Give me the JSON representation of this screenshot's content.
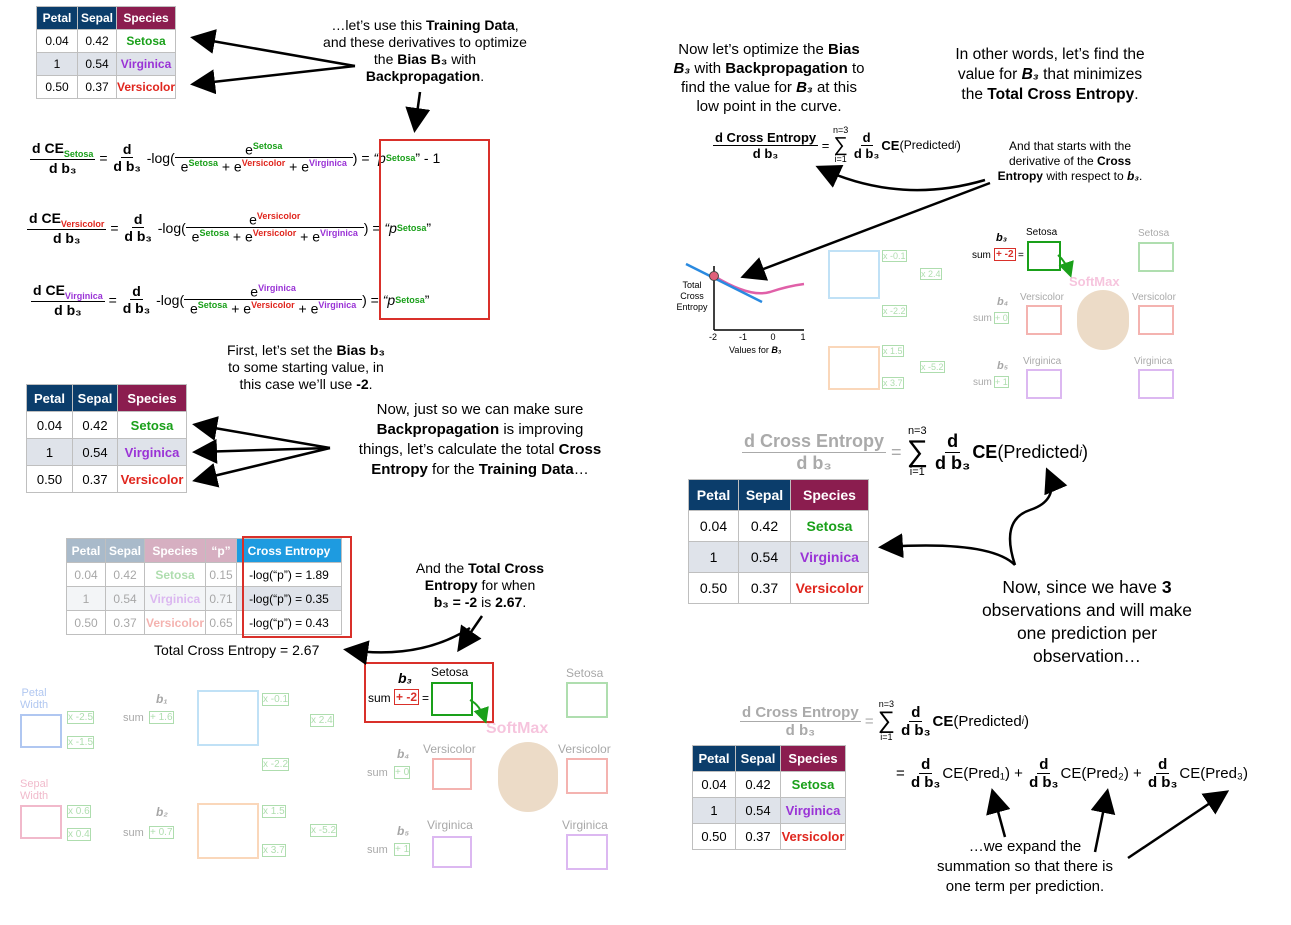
{
  "iris": {
    "headers": [
      "Petal",
      "Sepal",
      "Species"
    ],
    "rows": [
      {
        "petal": "0.04",
        "sepal": "0.42",
        "species": "Setosa"
      },
      {
        "petal": "1",
        "sepal": "0.54",
        "species": "Virginica"
      },
      {
        "petal": "0.50",
        "sepal": "0.37",
        "species": "Versicolor"
      }
    ]
  },
  "ce_table": {
    "headers": [
      "Petal",
      "Sepal",
      "Species",
      "“p”",
      "Cross Entropy"
    ],
    "p": [
      "0.15",
      "0.71",
      "0.65"
    ],
    "ce": [
      "-log(“p”) = 1.89",
      "-log(“p”) = 0.35",
      "-log(“p”) = 0.43"
    ],
    "total": "Total Cross Entropy = 2.67"
  },
  "text": {
    "intro_1": "…let’s use this",
    "intro_2": "Training Data",
    "intro_3": ",",
    "intro_4": "and these derivatives to optimize",
    "intro_5": "the",
    "intro_6": "Bias B₃",
    "intro_7": "with",
    "intro_8": "Backpropagation",
    "intro_9": ".",
    "first_1": "First, let’s set the",
    "first_2": "Bias b₃",
    "first_3": "to some starting value, in",
    "first_4": "this case we’ll use",
    "first_5": "-2",
    "first_6": ".",
    "now_1": "Now, just so we can make sure",
    "now_2": "Backpropagation",
    "now_3": "is improving",
    "now_4": "things, let’s calculate the total",
    "now_5": "Cross",
    "now_6": "Entropy",
    "now_7": "for the",
    "now_8": "Training Data",
    "now_9": "…",
    "andtotal_1": "And the",
    "andtotal_2": "Total Cross",
    "andtotal_3": "Entropy",
    "andtotal_4": "for when",
    "andtotal_5": "b₃ = -2",
    "andtotal_6": "is",
    "andtotal_7": "2.67",
    "andtotal_8": ".",
    "opt_1": "Now let’s optimize the",
    "opt_2": "Bias",
    "opt_3": "B₃",
    "opt_4": "with",
    "opt_5": "Backpropagation",
    "opt_6": "to",
    "opt_7": "find the value for",
    "opt_8": "B₃",
    "opt_9": "at this",
    "opt_10": "low point in the curve.",
    "other_1": "In other words, let’s find the",
    "other_2": "value for",
    "other_3": "B₃",
    "other_4": "that minimizes",
    "other_5": "the",
    "other_6": "Total Cross Entropy",
    "other_7": ".",
    "starts_1": "And that starts with the",
    "starts_2": "derivative of the",
    "starts_3": "Cross",
    "starts_4": "Entropy",
    "starts_5": "with respect to",
    "starts_6": "b₃",
    "starts_7": ".",
    "since_1": "Now, since we have",
    "since_2": "3",
    "since_3": "observations and will make",
    "since_4": "one prediction per",
    "since_5": "observation…",
    "expand_1": "…we expand the",
    "expand_2": "summation so that there is",
    "expand_3": "one term per prediction."
  },
  "equations": {
    "d": "d",
    "db3": "d b₃",
    "ce": "CE",
    "setosa": "Setosa",
    "versicolor": "Versicolor",
    "virginica": "Virginica",
    "e": "e",
    "plus": "+",
    "neglog": "-log(",
    "close": ") =",
    "eqsign": "=",
    "p_setosa_1": "“p",
    "p_setosa_2": "Setosa",
    "p_setosa_3": "” - 1",
    "p_setosa_4": "”",
    "dce_label": "d Cross Entropy",
    "sum_top": "n=3",
    "sum_sym": "∑",
    "sum_bot": "i=1",
    "ce_pred": "CE(Predicted",
    "ce_pred_i": "i",
    "ce_pred_close": ")",
    "pred1": "CE(Pred₁)",
    "pred2": "CE(Pred₂)",
    "pred3": "CE(Pred₃)"
  },
  "graph": {
    "ylabel_1": "Total",
    "ylabel_2": "Cross",
    "ylabel_3": "Entropy",
    "xlabel": "Values for",
    "xlabel_b": "B₃",
    "ticks": [
      "-2",
      "-1",
      "0",
      "1"
    ]
  },
  "network": {
    "petal_width": "Petal\nWidth",
    "sepal_width": "Sepal\nWidth",
    "w1": "x -2.5",
    "w2": "x -1.5",
    "w3": "x 0.6",
    "w4": "x 0.4",
    "b1_label": "b₁",
    "b1": "+ 1.6",
    "b2_label": "b₂",
    "b2": "+ 0.7",
    "w5": "x -0.1",
    "w6": "x 2.4",
    "w7": "x -2.2",
    "w8": "x 1.5",
    "w9": "x -5.2",
    "w10": "x 3.7",
    "b3_label": "b₃",
    "b3": "+ -2",
    "b4_label": "b₄",
    "b4": "+ 0",
    "b5_label": "b₅",
    "b5": "+ 1",
    "sum": "sum",
    "eq": "=",
    "setosa": "Setosa",
    "versicolor": "Versicolor",
    "virginica": "Virginica",
    "softmax": "SoftMax"
  },
  "colors": {
    "setosa": "#1aa01a",
    "virginica": "#9a33d6",
    "versicolor": "#e0261e",
    "header_blue": "#0b3d6b",
    "header_maroon": "#8b1d4f",
    "ce_header": "#1e9be0",
    "red_box": "#d9302a"
  }
}
